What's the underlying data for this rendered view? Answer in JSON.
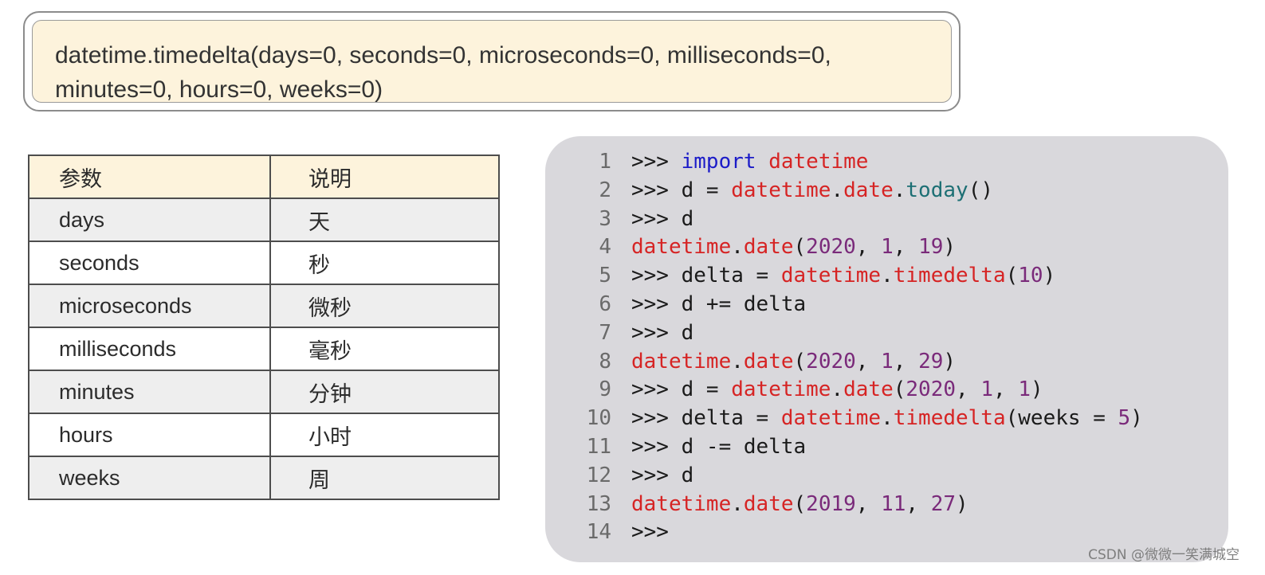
{
  "signature": {
    "line1": "datetime.timedelta(days=0, seconds=0, microseconds=0, milliseconds=0,",
    "line2": "minutes=0, hours=0, weeks=0)"
  },
  "params_table": {
    "headers": [
      "参数",
      "说明"
    ],
    "rows": [
      [
        "days",
        "天"
      ],
      [
        "seconds",
        "秒"
      ],
      [
        "microseconds",
        "微秒"
      ],
      [
        "milliseconds",
        "毫秒"
      ],
      [
        "minutes",
        "分钟"
      ],
      [
        "hours",
        "小时"
      ],
      [
        "weeks",
        "周"
      ]
    ]
  },
  "code": {
    "lines": [
      {
        "n": "1",
        "tokens": [
          [
            "op",
            ">>> "
          ],
          [
            "kw",
            "import"
          ],
          [
            "op",
            " "
          ],
          [
            "name",
            "datetime"
          ]
        ]
      },
      {
        "n": "2",
        "tokens": [
          [
            "op",
            ">>> d = "
          ],
          [
            "name",
            "datetime"
          ],
          [
            "op",
            "."
          ],
          [
            "name",
            "date"
          ],
          [
            "op",
            "."
          ],
          [
            "call",
            "today"
          ],
          [
            "op",
            "()"
          ]
        ]
      },
      {
        "n": "3",
        "tokens": [
          [
            "op",
            ">>> d"
          ]
        ]
      },
      {
        "n": "4",
        "tokens": [
          [
            "name",
            "datetime"
          ],
          [
            "op",
            "."
          ],
          [
            "name",
            "date"
          ],
          [
            "op",
            "("
          ],
          [
            "num",
            "2020"
          ],
          [
            "op",
            ", "
          ],
          [
            "num",
            "1"
          ],
          [
            "op",
            ", "
          ],
          [
            "num",
            "19"
          ],
          [
            "op",
            ")"
          ]
        ]
      },
      {
        "n": "5",
        "tokens": [
          [
            "op",
            ">>> delta = "
          ],
          [
            "name",
            "datetime"
          ],
          [
            "op",
            "."
          ],
          [
            "name",
            "timedelta"
          ],
          [
            "op",
            "("
          ],
          [
            "num",
            "10"
          ],
          [
            "op",
            ")"
          ]
        ]
      },
      {
        "n": "6",
        "tokens": [
          [
            "op",
            ">>> d += delta"
          ]
        ]
      },
      {
        "n": "7",
        "tokens": [
          [
            "op",
            ">>> d"
          ]
        ]
      },
      {
        "n": "8",
        "tokens": [
          [
            "name",
            "datetime"
          ],
          [
            "op",
            "."
          ],
          [
            "name",
            "date"
          ],
          [
            "op",
            "("
          ],
          [
            "num",
            "2020"
          ],
          [
            "op",
            ", "
          ],
          [
            "num",
            "1"
          ],
          [
            "op",
            ", "
          ],
          [
            "num",
            "29"
          ],
          [
            "op",
            ")"
          ]
        ]
      },
      {
        "n": "9",
        "tokens": [
          [
            "op",
            ">>> d = "
          ],
          [
            "name",
            "datetime"
          ],
          [
            "op",
            "."
          ],
          [
            "name",
            "date"
          ],
          [
            "op",
            "("
          ],
          [
            "num",
            "2020"
          ],
          [
            "op",
            ", "
          ],
          [
            "num",
            "1"
          ],
          [
            "op",
            ", "
          ],
          [
            "num",
            "1"
          ],
          [
            "op",
            ")"
          ]
        ]
      },
      {
        "n": "10",
        "tokens": [
          [
            "op",
            ">>> delta = "
          ],
          [
            "name",
            "datetime"
          ],
          [
            "op",
            "."
          ],
          [
            "name",
            "timedelta"
          ],
          [
            "op",
            "(weeks = "
          ],
          [
            "num",
            "5"
          ],
          [
            "op",
            ")"
          ]
        ]
      },
      {
        "n": "11",
        "tokens": [
          [
            "op",
            ">>> d -= delta"
          ]
        ]
      },
      {
        "n": "12",
        "tokens": [
          [
            "op",
            ">>> d"
          ]
        ]
      },
      {
        "n": "13",
        "tokens": [
          [
            "name",
            "datetime"
          ],
          [
            "op",
            "."
          ],
          [
            "name",
            "date"
          ],
          [
            "op",
            "("
          ],
          [
            "num",
            "2019"
          ],
          [
            "op",
            ", "
          ],
          [
            "num",
            "11"
          ],
          [
            "op",
            ", "
          ],
          [
            "num",
            "27"
          ],
          [
            "op",
            ")"
          ]
        ]
      },
      {
        "n": "14",
        "tokens": [
          [
            "op",
            ">>>"
          ]
        ]
      }
    ]
  },
  "watermark": "CSDN @微微一笑满城空",
  "colors": {
    "keyword": "#1c1cc8",
    "name": "#d62424",
    "call": "#1d6f74",
    "number": "#7a2a7a",
    "panel_bg": "#d9d8dc",
    "signature_bg": "#fdf3dc"
  }
}
